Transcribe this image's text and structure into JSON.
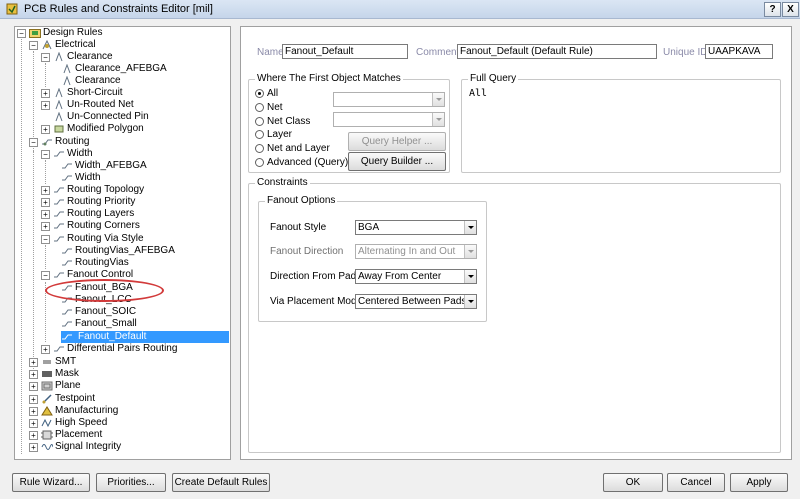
{
  "window": {
    "title": "PCB Rules and Constraints Editor [mil]",
    "help_btn": "?",
    "close_btn": "X"
  },
  "tree": {
    "items": [
      {
        "label": "Design Rules"
      },
      {
        "label": "Electrical"
      },
      {
        "label": "Clearance"
      },
      {
        "label": "Clearance_AFEBGA"
      },
      {
        "label": "Clearance"
      },
      {
        "label": "Short-Circuit"
      },
      {
        "label": "Un-Routed Net"
      },
      {
        "label": "Un-Connected Pin"
      },
      {
        "label": "Modified Polygon"
      },
      {
        "label": "Routing"
      },
      {
        "label": "Width"
      },
      {
        "label": "Width_AFEBGA"
      },
      {
        "label": "Width"
      },
      {
        "label": "Routing Topology"
      },
      {
        "label": "Routing Priority"
      },
      {
        "label": "Routing Layers"
      },
      {
        "label": "Routing Corners"
      },
      {
        "label": "Routing Via Style"
      },
      {
        "label": "RoutingVias_AFEBGA"
      },
      {
        "label": "RoutingVias"
      },
      {
        "label": "Fanout Control"
      },
      {
        "label": "Fanout_BGA"
      },
      {
        "label": "Fanout_LCC"
      },
      {
        "label": "Fanout_SOIC"
      },
      {
        "label": "Fanout_Small"
      },
      {
        "label": "Fanout_Default"
      },
      {
        "label": "Differential Pairs Routing"
      },
      {
        "label": "SMT"
      },
      {
        "label": "Mask"
      },
      {
        "label": "Plane"
      },
      {
        "label": "Testpoint"
      },
      {
        "label": "Manufacturing"
      },
      {
        "label": "High Speed"
      },
      {
        "label": "Placement"
      },
      {
        "label": "Signal Integrity"
      }
    ]
  },
  "rule": {
    "name_label": "Name",
    "name_value": "Fanout_Default",
    "comment_label": "Comment",
    "comment_value": "Fanout_Default (Default Rule)",
    "uid_label": "Unique ID",
    "uid_value": "UAAPKAVA"
  },
  "match": {
    "title": "Where The First Object Matches",
    "options": [
      "All",
      "Net",
      "Net Class",
      "Layer",
      "Net and Layer",
      "Advanced (Query)"
    ],
    "query_helper": "Query Helper ...",
    "query_builder": "Query Builder ..."
  },
  "full_query": {
    "title": "Full Query",
    "text": "All"
  },
  "constraints": {
    "title": "Constraints",
    "group_title": "Fanout Options",
    "fields": [
      {
        "label": "Fanout Style",
        "value": "BGA"
      },
      {
        "label": "Fanout Direction",
        "value": "Alternating In and Out"
      },
      {
        "label": "Direction From Pad",
        "value": "Away From Center"
      },
      {
        "label": "Via Placement Mode",
        "value": "Centered Between Pads"
      }
    ]
  },
  "footer": {
    "rule_wizard": "Rule Wizard...",
    "priorities": "Priorities...",
    "create_default": "Create Default Rules",
    "ok": "OK",
    "cancel": "Cancel",
    "apply": "Apply"
  },
  "colors": {
    "selection": "#3399ff",
    "annotation_ring": "#d23a3a"
  }
}
